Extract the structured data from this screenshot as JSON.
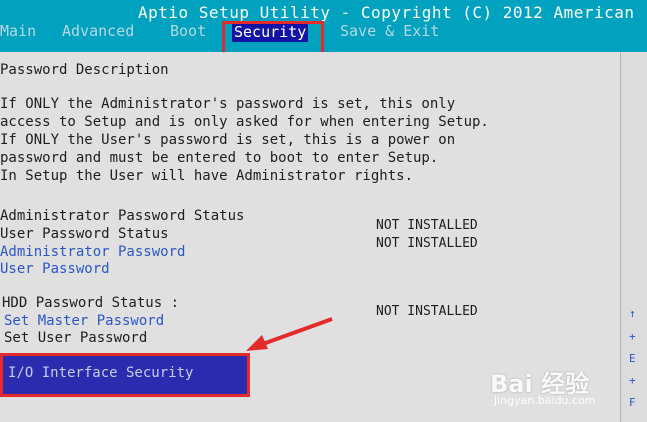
{
  "window": {
    "title": "Aptio Setup Utility - Copyright (C) 2012 American"
  },
  "tabs": [
    {
      "label": "Main"
    },
    {
      "label": "Advanced"
    },
    {
      "label": "Boot"
    },
    {
      "label": "Security"
    },
    {
      "label": "Save & Exit"
    }
  ],
  "main": {
    "heading": "Password Description",
    "desc_lines": [
      "If ONLY the Administrator's password is set, this only",
      "access to Setup and is only asked for when entering Setup.",
      "If ONLY the User's password is set, this is a power on",
      "password and must be entered to boot to enter Setup.",
      "In Setup the User will have Administrator rights."
    ],
    "admin_status_label": "Administrator Password Status",
    "admin_status_value": "NOT INSTALLED",
    "user_status_label": "User Password Status",
    "user_status_value": "NOT INSTALLED",
    "admin_password_link": "Administrator Password",
    "user_password_link": "User Password",
    "hdd_status_label": "HDD Password Status  :",
    "hdd_status_value": "NOT INSTALLED",
    "set_master_password": "Set Master Password",
    "set_user_password": "Set User Password",
    "io_interface_security": "I/O Interface Security"
  },
  "watermark": {
    "main": "Bai 经验",
    "sub": "jingyan.baidu.com"
  },
  "colors": {
    "highlight_box": "#e32b2b",
    "link_blue": "#2a56c9",
    "bios_blue": "#1313a6",
    "bar_cyan": "#00a2c0"
  }
}
